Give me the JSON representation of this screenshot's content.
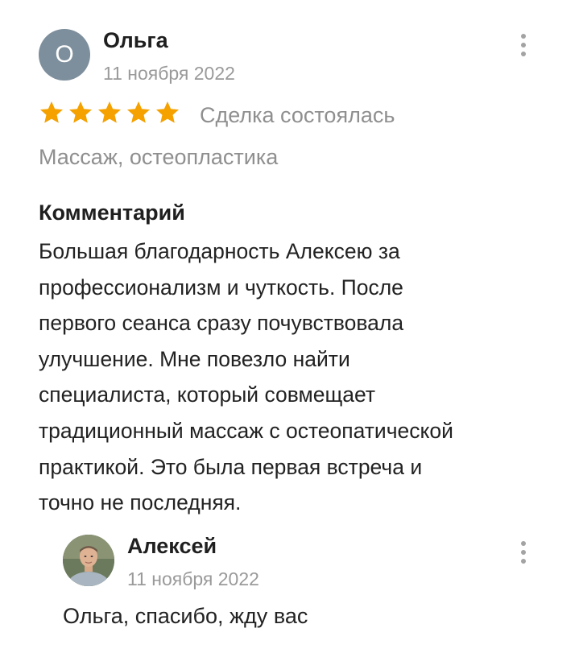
{
  "review": {
    "author": {
      "initial": "О",
      "name": "Ольга",
      "avatar_color": "#7d8e9c"
    },
    "date": "11 ноября 2022",
    "rating": 5,
    "rating_max": 5,
    "star_color": "#f5a100",
    "deal_status": "Сделка состоялась",
    "service": "Массаж, остеопластика",
    "comment_heading": "Комментарий",
    "comment_lines": [
      "Большая благодарность Алексею за",
      "профессионализм и чуткость. После",
      "первого сеанса сразу почувствовала",
      "улучшение. Мне повезло найти",
      "специалиста, который совмещает",
      "традиционный массаж с остеопатической",
      "практикой. Это была первая встреча и",
      "точно не последняя."
    ],
    "menu_icon": "more-vertical-icon"
  },
  "reply": {
    "author": {
      "name": "Алексей"
    },
    "date": "11 ноября 2022",
    "text": "Ольга, спасибо, жду вас",
    "menu_icon": "more-vertical-icon"
  }
}
